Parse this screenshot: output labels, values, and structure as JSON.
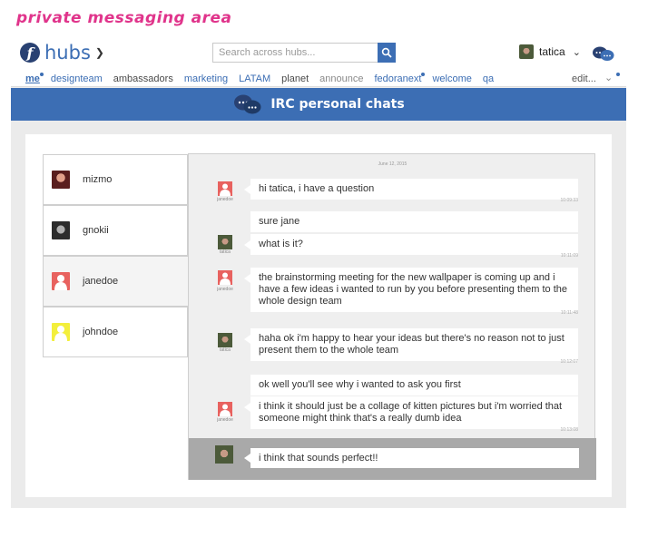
{
  "page_caption": "private messaging area",
  "header": {
    "logo_text": "hubs",
    "search_placeholder": "Search across hubs...",
    "user_name": "tatica"
  },
  "nav": {
    "items": [
      {
        "label": "me",
        "style": "me",
        "unread": true
      },
      {
        "label": "designteam",
        "style": "blue",
        "unread": false
      },
      {
        "label": "ambassadors",
        "style": "dark",
        "unread": false
      },
      {
        "label": "marketing",
        "style": "blue",
        "unread": false
      },
      {
        "label": "LATAM",
        "style": "blue",
        "unread": false
      },
      {
        "label": "planet",
        "style": "dark",
        "unread": false
      },
      {
        "label": "announce",
        "style": "grey",
        "unread": false
      },
      {
        "label": "fedoranext",
        "style": "blue",
        "unread": true
      },
      {
        "label": "welcome",
        "style": "blue",
        "unread": false
      },
      {
        "label": "qa",
        "style": "blue",
        "unread": false
      }
    ],
    "edit_label": "edit..."
  },
  "banner": {
    "title": "IRC personal chats"
  },
  "contacts": [
    {
      "name": "mizmo",
      "avatar": "mizmo"
    },
    {
      "name": "gnokii",
      "avatar": "gnokii"
    },
    {
      "name": "janedoe",
      "avatar": "default-red",
      "active": true
    },
    {
      "name": "johndoe",
      "avatar": "default-yellow"
    }
  ],
  "chat": {
    "date": "June 12, 2015",
    "messages": [
      {
        "sender": "janedoe",
        "text": "hi tatica, i have a question",
        "time": "10:09:33"
      },
      {
        "sender": "tatica",
        "text": "sure jane",
        "time": ""
      },
      {
        "sender": "tatica",
        "text": "what is it?",
        "time": "10:11:09"
      },
      {
        "sender": "janedoe",
        "text": "the brainstorming meeting for the new wallpaper is coming up and i have a few ideas i wanted to run by you before presenting them to the whole design team",
        "time": "10:11:48"
      },
      {
        "sender": "tatica",
        "text": "haha ok i'm happy to hear your ideas but there's no reason not to just present them to the whole team",
        "time": "10:12:07"
      },
      {
        "sender": "janedoe",
        "text": "ok well you'll see why i wanted to ask you first",
        "time": ""
      },
      {
        "sender": "janedoe",
        "text": "i think it should just be a collage of kitten pictures but i'm worried that someone might think that's a really dumb idea",
        "time": "10:13:08"
      }
    ],
    "composer_value": "i think that sounds perfect!!"
  },
  "colors": {
    "brand_blue": "#3c6eb4",
    "caption_pink": "#e0348b"
  },
  "icons": {
    "logo": "fedora-logo-icon",
    "search": "search-icon",
    "chat": "chat-bubbles-icon",
    "default_avatar": "default-user-icon"
  }
}
